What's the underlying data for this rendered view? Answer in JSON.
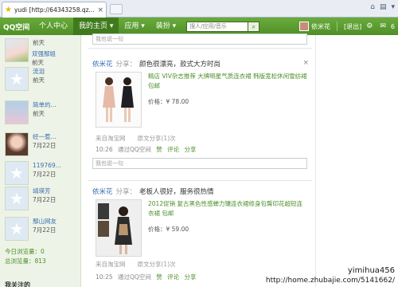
{
  "browser": {
    "tab_title": "yudi [http://64343258.qz...",
    "tab_close": "×"
  },
  "nav": {
    "logo": "QQ空间",
    "items": [
      "个人中心",
      "我的主页 ▾",
      "应用 ▾",
      "装扮 ▾"
    ],
    "search_placeholder": "搜人/应用/音乐",
    "search_button": "⌕",
    "username": "依米花",
    "logout": "[退出]",
    "settings_icon": "⚙",
    "mail_icon": "✉",
    "mail_count": "6"
  },
  "sidebar": {
    "friends": [
      {
        "name": "",
        "time": "前天",
        "pic": "photo1"
      },
      {
        "name": "双强鄢姐",
        "time": "前天",
        "pic": "photo3"
      },
      {
        "name": "流泪",
        "time": "前天",
        "pic": "dflt"
      },
      {
        "name": "简单的...",
        "time": "前天",
        "pic": "dflt"
      },
      {
        "name": "经一惹...",
        "time": "7月22日",
        "pic": "photo2"
      },
      {
        "name": "119769...",
        "time": "7月22日",
        "pic": "dflt"
      },
      {
        "name": "靖瑛芳",
        "time": "7月22日",
        "pic": "dflt"
      },
      {
        "name": "鄢山网友",
        "time": "7月22日",
        "pic": "dflt"
      }
    ],
    "today_visits": "今日浏览量：0",
    "total_visits": "总浏览量：813",
    "bottom_label": "我关注的"
  },
  "feed": {
    "top_comment_placeholder": "我也说一句",
    "posts": [
      {
        "who": "依米花",
        "verb": "分享：",
        "text": "颜色很漂亮，款式大方时尚",
        "desc": "精店 VIV杂志推荐 大牌明星气质连衣裙 韩版宽松休闲雪纺裙 包邮",
        "price": "价格：¥ 78.00",
        "source": "来自淘宝网　　原文分享(1)次",
        "time": "10:26",
        "via": "通过QQ空间",
        "like": "赞",
        "comment": "评论",
        "share": "分享",
        "placeholder": "我也说一句",
        "close": "×"
      },
      {
        "who": "依米花",
        "verb": "分享：",
        "text": "老板人很好，服务很热情",
        "desc": "2012促销 复古黑色性感蝉力镶连衣裙修身包臀印花超短连衣裙 包邮",
        "price": "价格：¥ 59.00",
        "source": "来自淘宝网　　原文分享(1)次",
        "time": "10:25",
        "via": "通过QQ空间",
        "like": "赞",
        "comment": "评论",
        "share": "分享"
      }
    ]
  },
  "watermark": {
    "line1": "yimihua456",
    "line2": "http://home.zhubajie.com/5141662/"
  }
}
